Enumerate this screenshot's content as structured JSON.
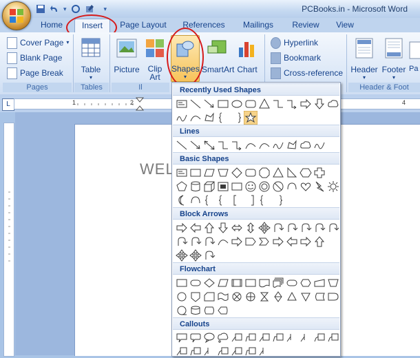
{
  "window": {
    "title": "PCBooks.in - Microsoft Word"
  },
  "tabs": [
    "Home",
    "Insert",
    "Page Layout",
    "References",
    "Mailings",
    "Review",
    "View"
  ],
  "ribbon": {
    "pages": {
      "items": [
        "Cover Page",
        "Blank Page",
        "Page Break"
      ],
      "label": "Pages"
    },
    "tables": {
      "button": "Table",
      "label": "Tables"
    },
    "illustrations": {
      "picture": "Picture",
      "clip_art_line1": "Clip",
      "clip_art_line2": "Art",
      "shapes": "Shapes",
      "smartart": "SmartArt",
      "chart": "Chart",
      "label": "Il"
    },
    "links": {
      "items": [
        "Hyperlink",
        "Bookmark",
        "Cross-reference"
      ]
    },
    "header_footer": {
      "header": "Header",
      "footer": "Footer",
      "page_number": "Pa Nu",
      "label": "Header & Foot"
    }
  },
  "ruler": {
    "corner": "L",
    "marks": [
      "1",
      "2",
      "4"
    ]
  },
  "document": {
    "visible_text": "WEL"
  },
  "gallery": {
    "sections": [
      "Recently Used Shapes",
      "Lines",
      "Basic Shapes",
      "Block Arrows",
      "Flowchart",
      "Callouts"
    ]
  },
  "icons": {
    "office_button": "office-logo-icon",
    "qat": [
      "save-icon",
      "undo-icon",
      "redo-icon",
      "customize-icon"
    ]
  },
  "colors": {
    "highlight": "#d61a1a",
    "ribbon_blue": "#15428b",
    "active_shape": "#f6d38a"
  }
}
